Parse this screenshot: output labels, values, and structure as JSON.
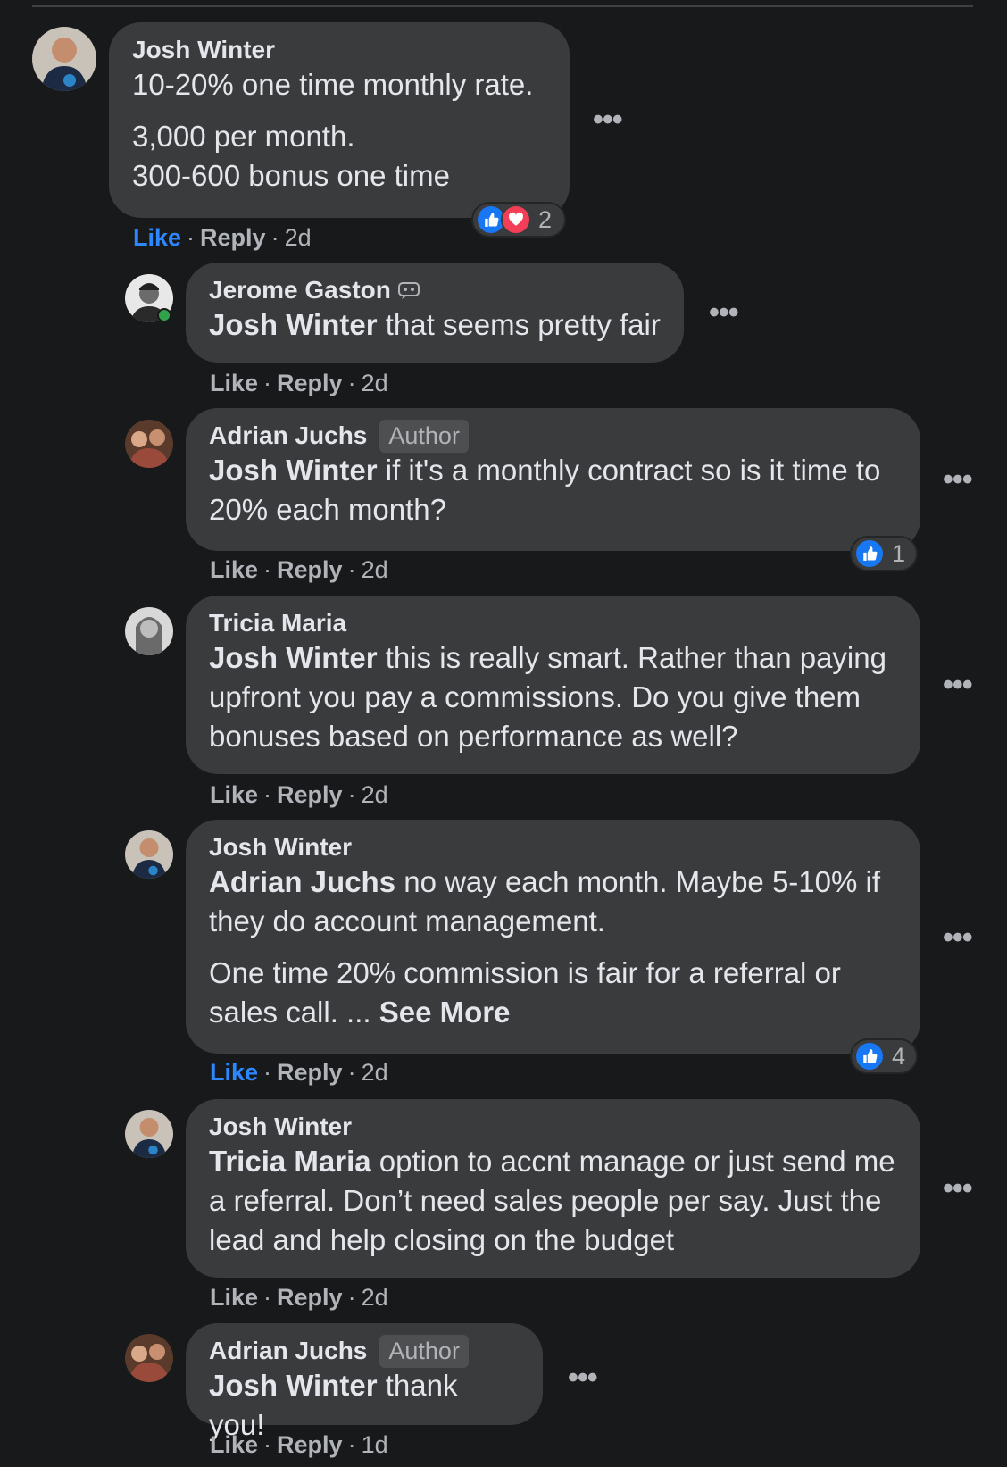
{
  "comments": [
    {
      "author": "Josh Winter",
      "badge": "",
      "mention": "",
      "paragraphs": [
        "10-20% one time monthly rate.",
        "3,000 per month.\n300-600 bonus one time"
      ],
      "actions": {
        "like": "Like",
        "reply": "Reply",
        "time": "2d",
        "liked": true
      },
      "reactions": {
        "types": [
          "like",
          "love"
        ],
        "count": "2"
      },
      "avatar_icon": "avatar-josh"
    },
    {
      "author": "Jerome Gaston",
      "badge": "",
      "mention": "Josh Winter",
      "paragraphs": [
        " that seems pretty fair"
      ],
      "actions": {
        "like": "Like",
        "reply": "Reply",
        "time": "2d",
        "liked": false
      },
      "reactions": null,
      "avatar_icon": "avatar-jerome",
      "online": true,
      "extra_icon": "gaming-video-creator-icon"
    },
    {
      "author": "Adrian Juchs",
      "badge": "Author",
      "mention": "Josh Winter",
      "paragraphs": [
        " if it's a monthly contract so is it time to 20% each month?"
      ],
      "actions": {
        "like": "Like",
        "reply": "Reply",
        "time": "2d",
        "liked": false
      },
      "reactions": {
        "types": [
          "like"
        ],
        "count": "1"
      },
      "avatar_icon": "avatar-adrian"
    },
    {
      "author": "Tricia Maria",
      "badge": "",
      "mention": "Josh Winter",
      "paragraphs": [
        " this is really smart. Rather than paying upfront you pay a commissions. Do you give them bonuses based on performance as well?"
      ],
      "actions": {
        "like": "Like",
        "reply": "Reply",
        "time": "2d",
        "liked": false
      },
      "reactions": null,
      "avatar_icon": "avatar-tricia"
    },
    {
      "author": "Josh Winter",
      "badge": "",
      "mention": "Adrian Juchs",
      "paragraphs": [
        " no way each month. Maybe 5-10% if they do account management.",
        "One time 20% commission is fair for a referral or sales call. ... "
      ],
      "see_more": "See More",
      "actions": {
        "like": "Like",
        "reply": "Reply",
        "time": "2d",
        "liked": true
      },
      "reactions": {
        "types": [
          "like"
        ],
        "count": "4"
      },
      "avatar_icon": "avatar-josh"
    },
    {
      "author": "Josh Winter",
      "badge": "",
      "mention": "Tricia Maria",
      "paragraphs": [
        " option to accnt manage or just send me a referral. Don’t need sales people per say. Just the lead and help closing on the budget"
      ],
      "actions": {
        "like": "Like",
        "reply": "Reply",
        "time": "2d",
        "liked": false
      },
      "reactions": null,
      "avatar_icon": "avatar-josh"
    },
    {
      "author": "Adrian Juchs",
      "badge": "Author",
      "mention": "Josh Winter",
      "paragraphs": [
        " thank you!"
      ],
      "actions": {
        "like": "Like",
        "reply": "Reply",
        "time": "1d",
        "liked": false
      },
      "reactions": null,
      "avatar_icon": "avatar-adrian"
    }
  ],
  "ui": {
    "more_dots": "•••",
    "separator": "·",
    "colors": {
      "background": "#18191a",
      "bubble": "#3a3b3c",
      "text": "#e4e6eb",
      "muted": "#b0b3b8",
      "link_active": "#2d88ff",
      "like": "#1877f2",
      "love": "#f33e58",
      "online": "#31a24c"
    }
  }
}
